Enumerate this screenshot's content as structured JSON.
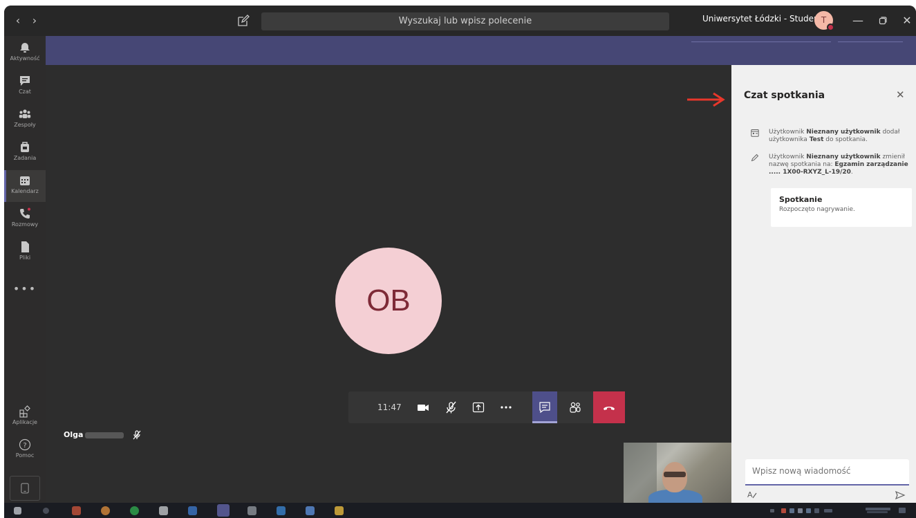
{
  "titlebar": {
    "search_placeholder": "Wyszukaj lub wpisz polecenie",
    "tenant": "Uniwersytet Łódzki - Student ⌄",
    "avatar_initial": "T"
  },
  "rail": {
    "items": [
      {
        "label": "Aktywność",
        "icon": "bell-icon"
      },
      {
        "label": "Czat",
        "icon": "chat-icon"
      },
      {
        "label": "Zespoły",
        "icon": "teams-icon"
      },
      {
        "label": "Zadania",
        "icon": "assignments-icon"
      },
      {
        "label": "Kalendarz",
        "icon": "calendar-icon"
      },
      {
        "label": "Rozmowy",
        "icon": "phone-icon"
      },
      {
        "label": "Pliki",
        "icon": "file-icon"
      }
    ],
    "more": "•••",
    "apps_label": "Aplikacje",
    "help_label": "Pomoc"
  },
  "stage": {
    "participant_initials": "OB",
    "participant_name": "Olga"
  },
  "callbar": {
    "time": "11:47"
  },
  "chat": {
    "title": "Czat spotkania",
    "messages": [
      {
        "prefix": "Użytkownik ",
        "actor": "Nieznany użytkownik",
        "mid": " dodał użytkownika ",
        "object": "Test",
        "suffix": " do spotkania."
      },
      {
        "prefix": "Użytkownik ",
        "actor": "Nieznany użytkownik",
        "mid": " zmienił nazwę spotkania na: ",
        "object": "Egzamin zarządzanie ..... 1X00-RXYZ_L-19/20",
        "suffix": "."
      }
    ],
    "card": {
      "title": "Spotkanie",
      "body": "Rozpoczęto nagrywanie."
    },
    "compose_placeholder": "Wpisz nową wiadomość"
  },
  "colors": {
    "accent": "#6264a7",
    "strip": "#464775",
    "hangup": "#c4314b",
    "annotation_arrow": "#e8372b"
  }
}
